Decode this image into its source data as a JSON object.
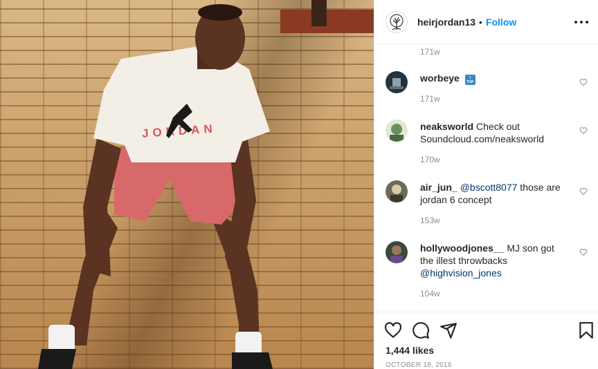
{
  "post": {
    "username": "heirjordan13",
    "separator": "•",
    "follow_label": "Follow",
    "top_age": "171w",
    "likes": "1,444 likes",
    "date": "October 18, 2016"
  },
  "comments": [
    {
      "username": "worbeye",
      "emoji": "🔝",
      "age": "171w"
    },
    {
      "username": "neaksworld",
      "text": "Check out Soundcloud.com/neaksworld",
      "age": "170w"
    },
    {
      "username": "air_jun_",
      "mention": "@bscott8077",
      "text": " those are jordan 6 concept",
      "age": "153w"
    },
    {
      "username": "hollywoodjones__",
      "text": "MJ son got the illest throwbacks ",
      "mention": "@highvision_jones",
      "age": "104w"
    }
  ],
  "photo": {
    "shirt_text": "JORDAN"
  },
  "icons": {
    "like": "heart-icon",
    "comment": "comment-icon",
    "share": "share-icon",
    "save": "bookmark-icon",
    "more": "more-options-icon"
  },
  "colors": {
    "link": "#0095f6",
    "mention": "#00376b",
    "secondary": "#8e8e8e",
    "text": "#262626"
  }
}
